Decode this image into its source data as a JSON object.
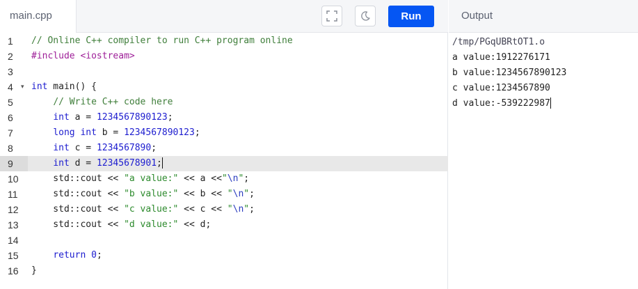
{
  "editor": {
    "file_tab": "main.cpp",
    "run_label": "Run",
    "icons": {
      "fullscreen": "fullscreen-icon",
      "theme": "moon-icon",
      "fold": "fold-arrow-icon"
    },
    "active_line": 9,
    "lines": [
      {
        "num": "1",
        "tokens": [
          {
            "t": "// Online C++ compiler to run C++ program online",
            "c": "comment"
          }
        ]
      },
      {
        "num": "2",
        "tokens": [
          {
            "t": "#include ",
            "c": "preproc"
          },
          {
            "t": "<iostream>",
            "c": "preproc"
          }
        ]
      },
      {
        "num": "3",
        "tokens": []
      },
      {
        "num": "4",
        "fold": true,
        "tokens": [
          {
            "t": "int",
            "c": "keyword"
          },
          {
            "t": " main() {",
            "c": ""
          }
        ]
      },
      {
        "num": "5",
        "tokens": [
          {
            "t": "    ",
            "c": ""
          },
          {
            "t": "// Write C++ code here",
            "c": "comment"
          }
        ]
      },
      {
        "num": "6",
        "tokens": [
          {
            "t": "    ",
            "c": ""
          },
          {
            "t": "int",
            "c": "keyword"
          },
          {
            "t": " a = ",
            "c": ""
          },
          {
            "t": "1234567890123",
            "c": "number"
          },
          {
            "t": ";",
            "c": ""
          }
        ]
      },
      {
        "num": "7",
        "tokens": [
          {
            "t": "    ",
            "c": ""
          },
          {
            "t": "long int",
            "c": "keyword"
          },
          {
            "t": " b = ",
            "c": ""
          },
          {
            "t": "1234567890123",
            "c": "number"
          },
          {
            "t": ";",
            "c": ""
          }
        ]
      },
      {
        "num": "8",
        "tokens": [
          {
            "t": "    ",
            "c": ""
          },
          {
            "t": "int",
            "c": "keyword"
          },
          {
            "t": " c = ",
            "c": ""
          },
          {
            "t": "1234567890",
            "c": "number"
          },
          {
            "t": ";",
            "c": ""
          }
        ]
      },
      {
        "num": "9",
        "tokens": [
          {
            "t": "    ",
            "c": ""
          },
          {
            "t": "int",
            "c": "keyword"
          },
          {
            "t": " d = ",
            "c": ""
          },
          {
            "t": "12345678901",
            "c": "number"
          },
          {
            "t": ";",
            "c": ""
          }
        ],
        "cursor": true
      },
      {
        "num": "10",
        "tokens": [
          {
            "t": "    std::cout << ",
            "c": ""
          },
          {
            "t": "\"a value:\"",
            "c": "string"
          },
          {
            "t": " << a <<",
            "c": ""
          },
          {
            "t": "\"",
            "c": "string"
          },
          {
            "t": "\\n",
            "c": "escape"
          },
          {
            "t": "\"",
            "c": "string"
          },
          {
            "t": ";",
            "c": ""
          }
        ]
      },
      {
        "num": "11",
        "tokens": [
          {
            "t": "    std::cout << ",
            "c": ""
          },
          {
            "t": "\"b value:\"",
            "c": "string"
          },
          {
            "t": " << b << ",
            "c": ""
          },
          {
            "t": "\"",
            "c": "string"
          },
          {
            "t": "\\n",
            "c": "escape"
          },
          {
            "t": "\"",
            "c": "string"
          },
          {
            "t": ";",
            "c": ""
          }
        ]
      },
      {
        "num": "12",
        "tokens": [
          {
            "t": "    std::cout << ",
            "c": ""
          },
          {
            "t": "\"c value:\"",
            "c": "string"
          },
          {
            "t": " << c << ",
            "c": ""
          },
          {
            "t": "\"",
            "c": "string"
          },
          {
            "t": "\\n",
            "c": "escape"
          },
          {
            "t": "\"",
            "c": "string"
          },
          {
            "t": ";",
            "c": ""
          }
        ]
      },
      {
        "num": "13",
        "tokens": [
          {
            "t": "    std::cout << ",
            "c": ""
          },
          {
            "t": "\"d value:\"",
            "c": "string"
          },
          {
            "t": " << d;",
            "c": ""
          }
        ]
      },
      {
        "num": "14",
        "tokens": []
      },
      {
        "num": "15",
        "tokens": [
          {
            "t": "    ",
            "c": ""
          },
          {
            "t": "return",
            "c": "keyword"
          },
          {
            "t": " ",
            "c": ""
          },
          {
            "t": "0",
            "c": "number"
          },
          {
            "t": ";",
            "c": ""
          }
        ]
      },
      {
        "num": "16",
        "tokens": [
          {
            "t": "}",
            "c": ""
          }
        ]
      }
    ]
  },
  "output": {
    "title": "Output",
    "lines": [
      "/tmp/PGqUBRtOT1.o",
      "a value:1912276171",
      "b value:1234567890123",
      "c value:1234567890",
      "d value:-539222987"
    ]
  },
  "colors": {
    "run_button": "#0556f3",
    "keyword": "#1c1ccf",
    "comment": "#3f7e3a",
    "string": "#2c8a2c",
    "preprocessor": "#9e1f98"
  }
}
